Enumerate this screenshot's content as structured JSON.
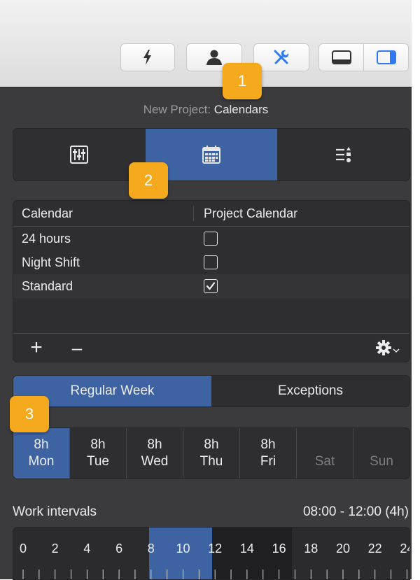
{
  "toolbar": {
    "buttons": [
      {
        "name": "lightning-icon"
      },
      {
        "name": "person-icon"
      },
      {
        "name": "tools-icon"
      }
    ],
    "layout_toggles": [
      "bottom-panel-icon",
      "right-sidebar-icon"
    ],
    "accent": "#2f7bf5"
  },
  "panel": {
    "title_prefix": "New Project:",
    "title_value": "Calendars",
    "mode_tabs": [
      "sliders-icon",
      "calendar-icon",
      "list-sort-icon"
    ],
    "active_mode": 1
  },
  "calendar_table": {
    "headers": [
      "Calendar",
      "Project Calendar"
    ],
    "rows": [
      {
        "name": "24 hours",
        "checked": false
      },
      {
        "name": "Night Shift",
        "checked": false
      },
      {
        "name": "Standard",
        "checked": true
      }
    ],
    "add_label": "+",
    "remove_label": "–"
  },
  "week_tabs": {
    "regular": "Regular Week",
    "exceptions": "Exceptions",
    "active": "regular"
  },
  "days": [
    {
      "hours": "8h",
      "name": "Mon",
      "active": true
    },
    {
      "hours": "8h",
      "name": "Tue"
    },
    {
      "hours": "8h",
      "name": "Wed"
    },
    {
      "hours": "8h",
      "name": "Thu"
    },
    {
      "hours": "8h",
      "name": "Fri"
    },
    {
      "hours": "",
      "name": "Sat",
      "off": true
    },
    {
      "hours": "",
      "name": "Sun",
      "off": true
    }
  ],
  "work_intervals": {
    "label": "Work intervals",
    "value": "08:00 - 12:00 (4h)",
    "hour_labels": [
      "0",
      "2",
      "4",
      "6",
      "8",
      "10",
      "12",
      "14",
      "16",
      "18",
      "20",
      "22",
      "24"
    ]
  },
  "badges": [
    "1",
    "2",
    "3"
  ],
  "colors": {
    "selection_blue": "#3d63a2",
    "badge_orange": "#f4aa1c",
    "panel_bg": "#3b3b3d"
  }
}
